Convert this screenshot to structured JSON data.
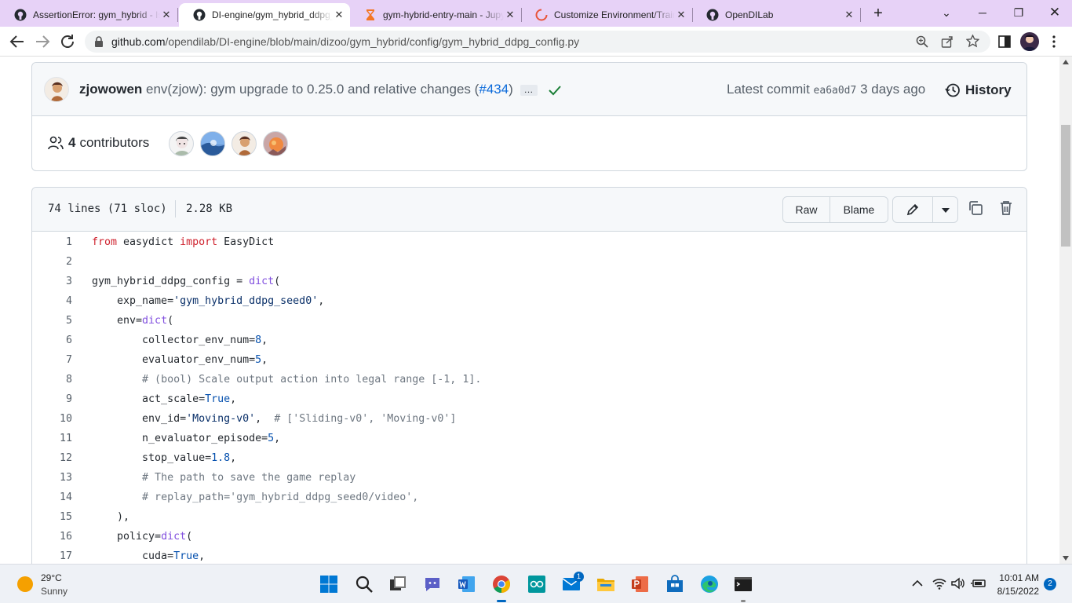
{
  "browser": {
    "tabs": [
      {
        "title": "AssertionError: gym_hybrid - Is",
        "icon": "github-icon",
        "active": false
      },
      {
        "title": "DI-engine/gym_hybrid_ddpg_config.py",
        "icon": "github-icon",
        "active": true
      },
      {
        "title": "gym-hybrid-entry-main - Jupyter",
        "icon": "hourglass-icon",
        "active": false
      },
      {
        "title": "Customize Environment/Training",
        "icon": "loading-icon",
        "active": false
      },
      {
        "title": "OpenDILab",
        "icon": "github-icon",
        "active": false
      }
    ],
    "url_host": "github.com",
    "url_path": "/opendilab/DI-engine/blob/main/dizoo/gym_hybrid/config/gym_hybrid_ddpg_config.py"
  },
  "commit": {
    "author": "zjowowen",
    "message": "env(zjow): gym upgrade to 0.25.0 and relative changes (",
    "pr": "#434",
    "message_end": ")",
    "ellipsis": "…",
    "latest_label": "Latest commit",
    "sha": "ea6a0d7",
    "time": "3 days ago",
    "history": "History"
  },
  "contributors": {
    "count": "4",
    "label": "contributors"
  },
  "file": {
    "lines_info": "74 lines (71 sloc)",
    "size": "2.28 KB",
    "raw": "Raw",
    "blame": "Blame"
  },
  "code_lines": [
    {
      "n": "1",
      "text": "from easydict import EasyDict"
    },
    {
      "n": "2",
      "text": ""
    },
    {
      "n": "3",
      "text": "gym_hybrid_ddpg_config = dict("
    },
    {
      "n": "4",
      "text": "    exp_name='gym_hybrid_ddpg_seed0',"
    },
    {
      "n": "5",
      "text": "    env=dict("
    },
    {
      "n": "6",
      "text": "        collector_env_num=8,"
    },
    {
      "n": "7",
      "text": "        evaluator_env_num=5,"
    },
    {
      "n": "8",
      "text": "        # (bool) Scale output action into legal range [-1, 1]."
    },
    {
      "n": "9",
      "text": "        act_scale=True,"
    },
    {
      "n": "10",
      "text": "        env_id='Moving-v0',  # ['Sliding-v0', 'Moving-v0']"
    },
    {
      "n": "11",
      "text": "        n_evaluator_episode=5,"
    },
    {
      "n": "12",
      "text": "        stop_value=1.8,"
    },
    {
      "n": "13",
      "text": "        # The path to save the game replay"
    },
    {
      "n": "14",
      "text": "        # replay_path='gym_hybrid_ddpg_seed0/video',"
    },
    {
      "n": "15",
      "text": "    ),"
    },
    {
      "n": "16",
      "text": "    policy=dict("
    },
    {
      "n": "17",
      "text": "        cuda=True,"
    }
  ],
  "taskbar": {
    "weather_temp": "29°C",
    "weather_desc": "Sunny",
    "time": "10:01 AM",
    "date": "8/15/2022",
    "notifications": "2",
    "mail_badge": "1"
  }
}
